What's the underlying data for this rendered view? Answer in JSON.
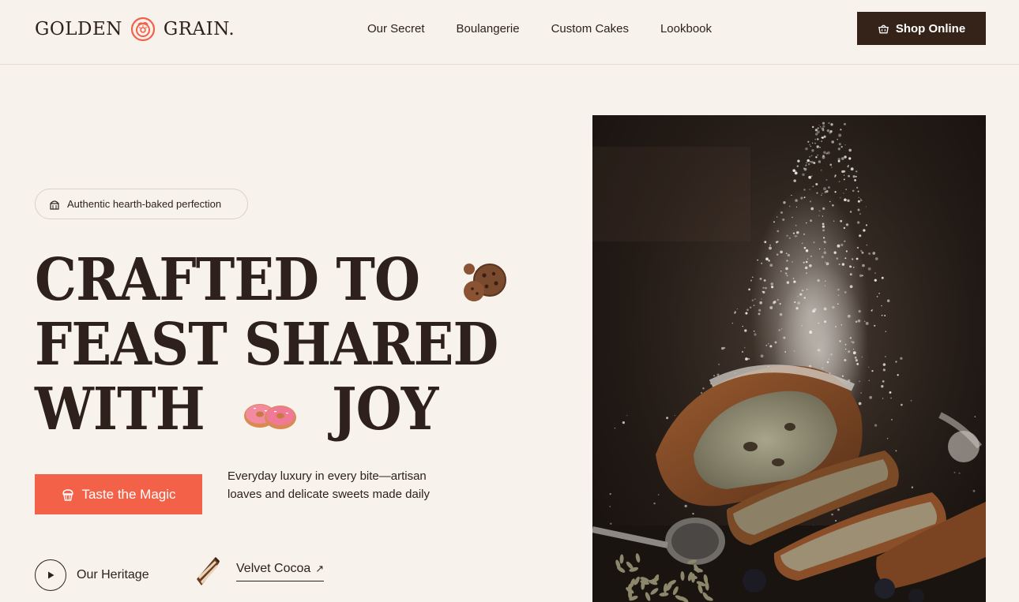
{
  "brand": {
    "name_left": "GOLDEN",
    "name_right": "GRAIN.",
    "logo_icon": "donut-logo-icon",
    "accent_color": "#f46149"
  },
  "nav": {
    "items": [
      {
        "label": "Our Secret"
      },
      {
        "label": "Boulangerie"
      },
      {
        "label": "Custom Cakes"
      },
      {
        "label": "Lookbook"
      }
    ]
  },
  "header": {
    "shop_label": "Shop Online",
    "shop_icon": "basket-icon",
    "shop_color": "#35231a"
  },
  "hero": {
    "badge_label": "Authentic hearth-baked perfection",
    "badge_icon": "bakery-icon",
    "headline": {
      "line1": "CRAFTED TO",
      "line2": "FEAST SHARED",
      "line3a": "WITH",
      "line3b": "JOY"
    },
    "headline_icons": [
      "cookies-icon",
      "donuts-icon"
    ],
    "cta_label": "Taste the Magic",
    "cta_icon": "cupcake-icon",
    "tagline": "Everyday luxury in every bite—artisan loaves and delicate sweets made daily",
    "heritage_label": "Our Heritage",
    "heritage_icon": "play-icon",
    "cocoa_label": "Velvet Cocoa",
    "cocoa_arrow": "↗",
    "cocoa_icon": "cake-slice-icon",
    "image_icon": "bread-flour-photo"
  }
}
